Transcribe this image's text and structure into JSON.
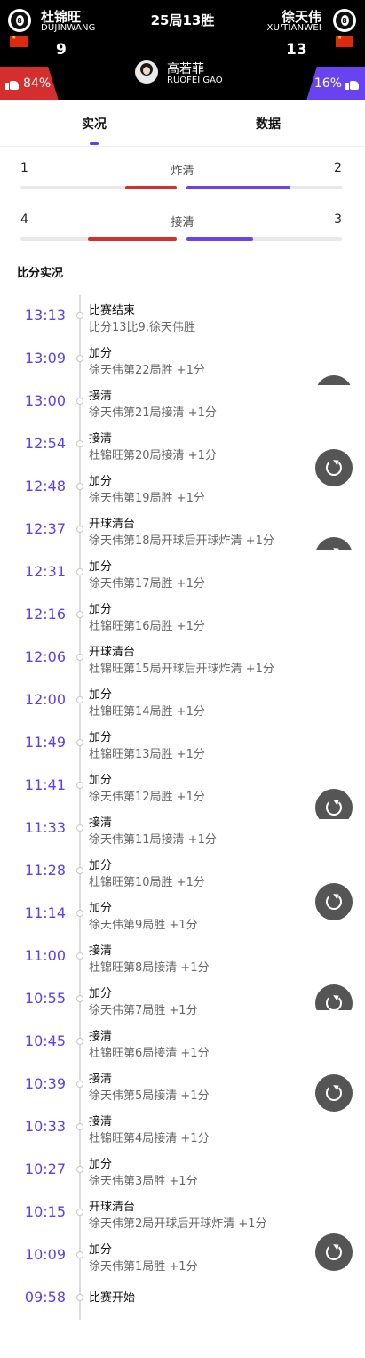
{
  "header": {
    "match_title": "25局13胜",
    "player_left": {
      "name_cn": "杜锦旺",
      "name_en": "DUJINWANG",
      "score": "9",
      "ball_number": "8"
    },
    "player_right": {
      "name_cn": "徐天伟",
      "name_en": "XU'TIANWEI",
      "score": "13",
      "ball_number": "8"
    },
    "referee": {
      "name_cn": "高若菲",
      "name_en": "RUOFEI GAO"
    },
    "vote_left": "84%",
    "vote_right": "16%"
  },
  "tabs": [
    "实况",
    "数据"
  ],
  "stats": [
    {
      "label": "炸清",
      "left": "1",
      "right": "2",
      "left_fraction": 0.33,
      "right_fraction": 0.67
    },
    {
      "label": "接清",
      "left": "4",
      "right": "3",
      "left_fraction": 0.57,
      "right_fraction": 0.43
    }
  ],
  "section_title": "比分实况",
  "colors": {
    "accent": "#5b3ff0",
    "left": "#d42e2e",
    "right": "#6a43f0"
  },
  "events": [
    {
      "time": "13:13",
      "title": "比赛结束",
      "detail": "比分13比9,徐天伟胜"
    },
    {
      "time": "13:09",
      "title": "加分",
      "detail": "徐天伟第22局胜 +1分"
    },
    {
      "time": "13:00",
      "title": "接清",
      "detail": "徐天伟第21局接清 +1分"
    },
    {
      "time": "12:54",
      "title": "接清",
      "detail": "杜锦旺第20局接清 +1分"
    },
    {
      "time": "12:48",
      "title": "加分",
      "detail": "徐天伟第19局胜 +1分"
    },
    {
      "time": "12:37",
      "title": "开球清台",
      "detail": "徐天伟第18局开球后开球炸清 +1分"
    },
    {
      "time": "12:31",
      "title": "加分",
      "detail": "徐天伟第17局胜 +1分"
    },
    {
      "time": "12:16",
      "title": "加分",
      "detail": "杜锦旺第16局胜 +1分"
    },
    {
      "time": "12:06",
      "title": "开球清台",
      "detail": "杜锦旺第15局开球后开球炸清 +1分"
    },
    {
      "time": "12:00",
      "title": "加分",
      "detail": "杜锦旺第14局胜 +1分"
    },
    {
      "time": "11:49",
      "title": "加分",
      "detail": "杜锦旺第13局胜 +1分"
    },
    {
      "time": "11:41",
      "title": "加分",
      "detail": "徐天伟第12局胜 +1分"
    },
    {
      "time": "11:33",
      "title": "接清",
      "detail": "徐天伟第11局接清 +1分"
    },
    {
      "time": "11:28",
      "title": "加分",
      "detail": "杜锦旺第10局胜 +1分"
    },
    {
      "time": "11:14",
      "title": "加分",
      "detail": "徐天伟第9局胜 +1分"
    },
    {
      "time": "11:00",
      "title": "接清",
      "detail": "杜锦旺第8局接清 +1分"
    },
    {
      "time": "10:55",
      "title": "加分",
      "detail": "徐天伟第7局胜 +1分"
    },
    {
      "time": "10:45",
      "title": "接清",
      "detail": "杜锦旺第6局接清 +1分"
    },
    {
      "time": "10:39",
      "title": "接清",
      "detail": "徐天伟第5局接清 +1分"
    },
    {
      "time": "10:33",
      "title": "接清",
      "detail": "杜锦旺第4局接清 +1分"
    },
    {
      "time": "10:27",
      "title": "加分",
      "detail": "徐天伟第3局胜 +1分"
    },
    {
      "time": "10:15",
      "title": "开球清台",
      "detail": "徐天伟第2局开球后开球炸清 +1分"
    },
    {
      "time": "10:09",
      "title": "加分",
      "detail": "徐天伟第1局胜 +1分"
    },
    {
      "time": "09:58",
      "title": "比赛开始",
      "detail": ""
    }
  ],
  "replay_icon": "replay-icon"
}
